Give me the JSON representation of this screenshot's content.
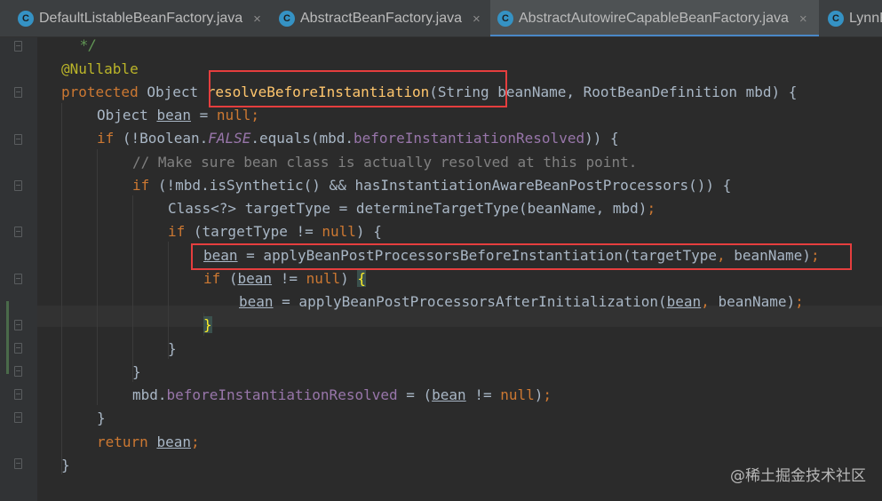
{
  "tabs": [
    {
      "label": "DefaultListableBeanFactory.java",
      "icon": "class-c-icon",
      "close": "×"
    },
    {
      "label": "AbstractBeanFactory.java",
      "icon": "class-c-icon",
      "close": "×"
    },
    {
      "label": "AbstractAutowireCapableBeanFactory.java",
      "icon": "class-c-icon",
      "close": "×"
    },
    {
      "label": "LynnB",
      "icon": "class-c-icon"
    }
  ],
  "code": {
    "l1": " */",
    "l2": "@Nullable",
    "l3": {
      "kw": "protected",
      "t1": " Object ",
      "fn": "resolveBeforeInstantiation",
      "t2": "(String beanName, RootBeanDefinition mbd) {"
    },
    "l4": {
      "t1": "Object ",
      "v": "bean",
      "t2": " = ",
      "kw": "null",
      "t3": ";"
    },
    "l5": {
      "kw": "if",
      "t1": " (!Boolean.",
      "f1": "FALSE",
      "t2": ".equals(mbd.",
      "f2": "beforeInstantiationResolved",
      "t3": ")) {"
    },
    "l6": "// Make sure bean class is actually resolved at this point.",
    "l7": {
      "kw": "if",
      "t1": " (!mbd.isSynthetic() && hasInstantiationAwareBeanPostProcessors()) {"
    },
    "l8": {
      "t1": "Class<?> targetType = determineTargetType(beanName, mbd)",
      "t2": ";"
    },
    "l9": {
      "kw": "if",
      "t1": " (targetType != ",
      "kw2": "null",
      "t2": ") {"
    },
    "l10": {
      "v": "bean",
      "t1": " = applyBeanPostProcessorsBeforeInstantiation(targetType",
      "c": ",",
      "t2": " beanName)",
      "s": ";"
    },
    "l11": {
      "kw": "if",
      "t1": " (",
      "v": "bean",
      "t2": " != ",
      "kw2": "null",
      "t3": ") ",
      "b": "{"
    },
    "l12": {
      "v": "bean",
      "t1": " = applyBeanPostProcessorsAfterInitialization(",
      "v2": "bean",
      "c": ",",
      "t2": " beanName)",
      "s": ";"
    },
    "l13": "}",
    "l14": "}",
    "l15": "}",
    "l16": {
      "t1": "mbd.",
      "f": "beforeInstantiationResolved",
      "t2": " = (",
      "v": "bean",
      "t3": " != ",
      "kw": "null",
      "t4": ")",
      "s": ";"
    },
    "l17": "}",
    "l18": {
      "kw": "return",
      "t1": " ",
      "v": "bean",
      "s": ";"
    },
    "l19": "}"
  },
  "watermark": "@稀土掘金技术社区"
}
